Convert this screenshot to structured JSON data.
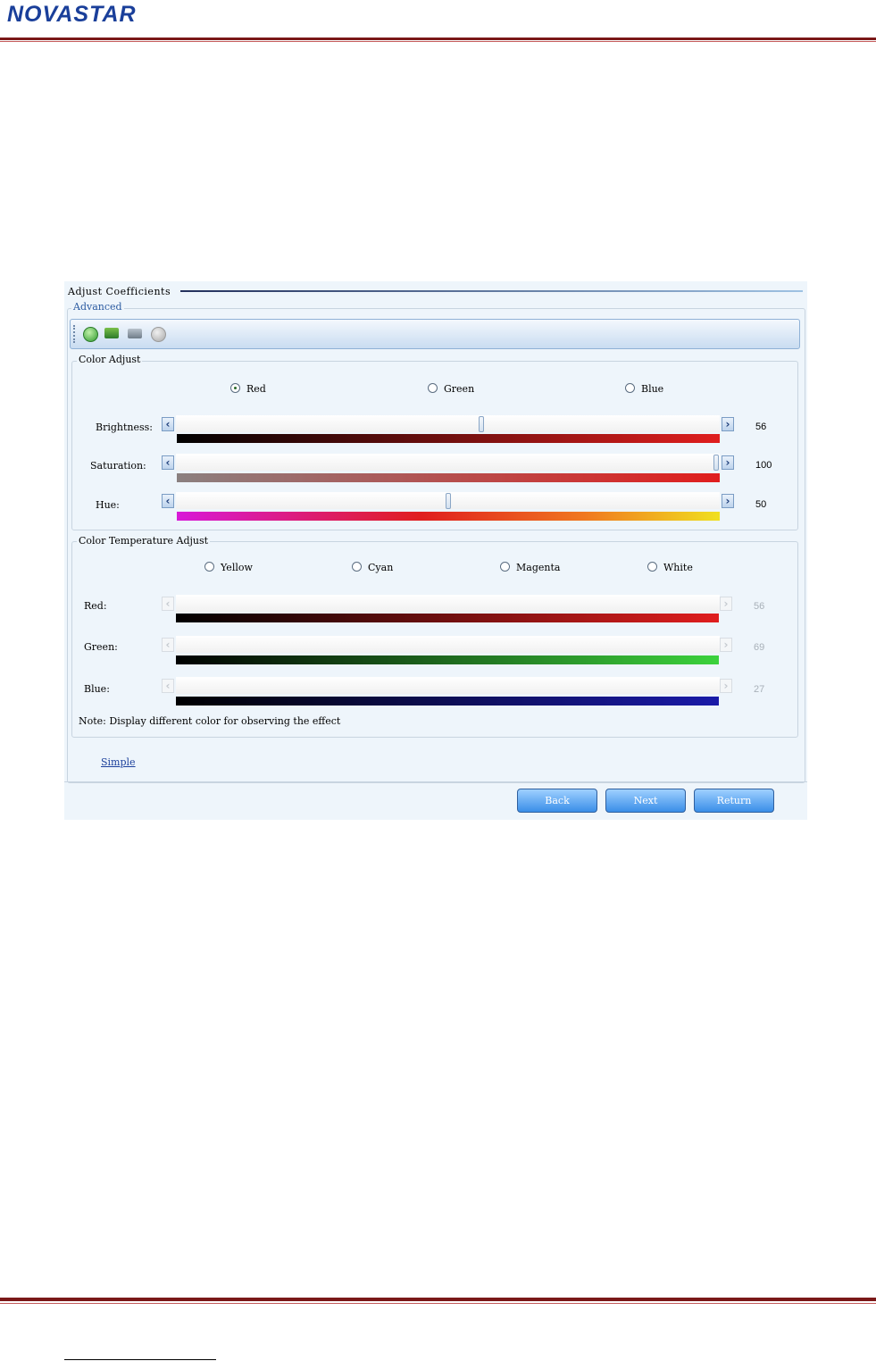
{
  "header": {
    "logo_text": "NOVASTAR"
  },
  "app": {
    "title": "Adjust Coefficients",
    "mode": "Advanced",
    "toolbar_icons": [
      "add-green-icon",
      "open-folder-icon",
      "edit-icon",
      "refresh-icon"
    ],
    "color_adjust": {
      "legend": "Color Adjust",
      "channels": [
        "Red",
        "Green",
        "Blue"
      ],
      "selected": "Red",
      "sliders": [
        {
          "label": "Brightness:",
          "value": "56",
          "level": 56
        },
        {
          "label": "Saturation:",
          "value": "100",
          "level": 100
        },
        {
          "label": "Hue:",
          "value": "50",
          "level": 50
        }
      ]
    },
    "temp_adjust": {
      "legend": "Color Temperature Adjust",
      "presets": [
        "Yellow",
        "Cyan",
        "Magenta",
        "White"
      ],
      "sliders": [
        {
          "label": "Red:",
          "value": "56"
        },
        {
          "label": "Green:",
          "value": "69"
        },
        {
          "label": "Blue:",
          "value": "27"
        }
      ],
      "note": "Note: Display different color for observing the effect"
    },
    "simple_link": "Simple",
    "buttons": {
      "back": "Back",
      "next": "Next",
      "return": "Return"
    },
    "colors": {
      "accent": "#2f5f9e",
      "red": "#e01e1e",
      "green": "#3cd23c",
      "blue": "#1a1aa8",
      "header_rule": "#7a1818"
    }
  }
}
